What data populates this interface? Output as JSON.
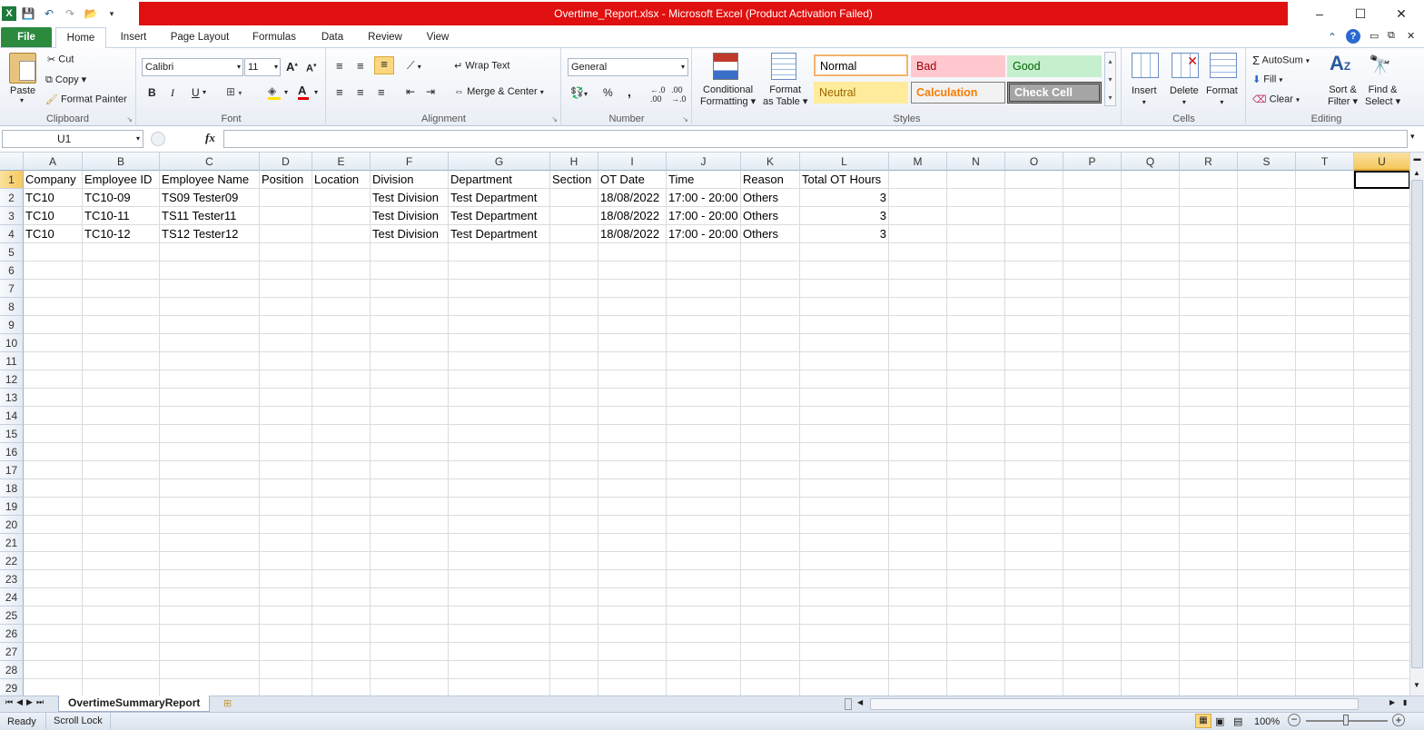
{
  "window": {
    "title": "Overtime_Report.xlsx  -  Microsoft Excel (Product Activation Failed)",
    "minimize": "–",
    "maximize": "☐",
    "close": "✕"
  },
  "tabs": [
    {
      "label": "File"
    },
    {
      "label": "Home"
    },
    {
      "label": "Insert"
    },
    {
      "label": "Page Layout"
    },
    {
      "label": "Formulas"
    },
    {
      "label": "Data"
    },
    {
      "label": "Review"
    },
    {
      "label": "View"
    }
  ],
  "ribbon": {
    "clipboard": {
      "paste": "Paste",
      "cut": "Cut",
      "copy": "Copy",
      "format_painter": "Format Painter",
      "label": "Clipboard"
    },
    "font": {
      "name": "Calibri",
      "size": "11",
      "bold": "B",
      "italic": "I",
      "underline": "U",
      "label": "Font"
    },
    "alignment": {
      "wrap": "Wrap Text",
      "merge": "Merge & Center",
      "label": "Alignment"
    },
    "number": {
      "format": "General",
      "percent": "%",
      "comma": ",",
      "label": "Number"
    },
    "styles_group": {
      "conditional": "Conditional",
      "conditional2": "Formatting",
      "format_table": "Format",
      "format_table2": "as Table",
      "normal": "Normal",
      "bad": "Bad",
      "good": "Good",
      "neutral": "Neutral",
      "calculation": "Calculation",
      "check_cell": "Check Cell",
      "label": "Styles"
    },
    "cells": {
      "insert": "Insert",
      "delete": "Delete",
      "format": "Format",
      "label": "Cells"
    },
    "editing": {
      "autosum": "AutoSum",
      "fill": "Fill",
      "clear": "Clear",
      "sort": "Sort &",
      "sort2": "Filter",
      "find": "Find &",
      "find2": "Select",
      "label": "Editing"
    }
  },
  "formula_bar": {
    "name_box": "U1",
    "fx": "fx",
    "value": ""
  },
  "columns": [
    "A",
    "B",
    "C",
    "D",
    "E",
    "F",
    "G",
    "H",
    "I",
    "J",
    "K",
    "L",
    "M",
    "N",
    "O",
    "P",
    "Q",
    "R",
    "S",
    "T",
    "U"
  ],
  "rows": [
    [
      "Company",
      "Employee ID",
      "Employee Name",
      "Position",
      "Location",
      "Division",
      "Department",
      "Section",
      "OT Date",
      "Time",
      "Reason",
      "Total OT Hours"
    ],
    [
      "TC10",
      "TC10-09",
      "TS09 Tester09",
      "",
      "",
      "Test Division",
      "Test Department",
      "",
      "18/08/2022",
      "17:00 - 20:00",
      "Others",
      "3"
    ],
    [
      "TC10",
      "TC10-11",
      "TS11 Tester11",
      "",
      "",
      "Test Division",
      "Test Department",
      "",
      "18/08/2022",
      "17:00 - 20:00",
      "Others",
      "3"
    ],
    [
      "TC10",
      "TC10-12",
      "TS12 Tester12",
      "",
      "",
      "Test Division",
      "Test Department",
      "",
      "18/08/2022",
      "17:00 - 20:00",
      "Others",
      "3"
    ]
  ],
  "row_count": 29,
  "sheet_tab": "OvertimeSummaryReport",
  "status": {
    "ready": "Ready",
    "scroll_lock": "Scroll Lock",
    "zoom": "100%"
  }
}
